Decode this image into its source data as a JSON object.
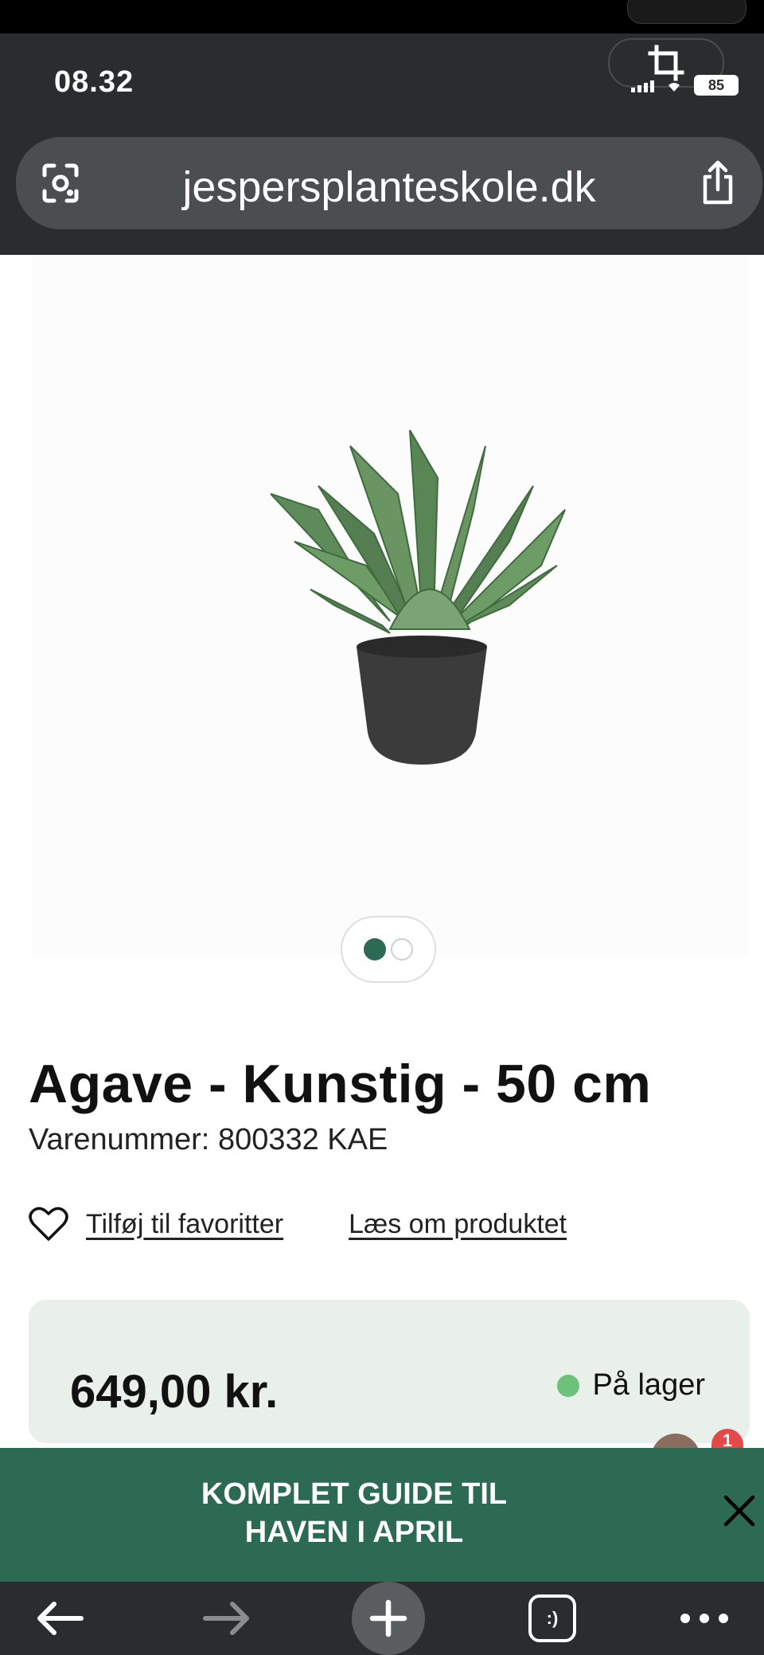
{
  "status_bar": {
    "time": "08.32",
    "battery": "85"
  },
  "browser": {
    "url": "jespersplanteskole.dk",
    "icons": [
      "lens-icon",
      "share-icon",
      "crop-icon"
    ]
  },
  "gallery": {
    "image_alt": "Agave - Kunstig - 50 cm",
    "slide_count": 2,
    "active_slide": 1
  },
  "product": {
    "title": "Agave - Kunstig - 50 cm",
    "sku_label": "Varenummer:",
    "sku": "800332 KAE",
    "favorite_label": "Tilføj til favoritter",
    "read_more_label": "Læs om produktet",
    "price": "649,00 kr.",
    "stock_status": "På lager",
    "stock_color": "#6cc27a"
  },
  "chat": {
    "badge_count": "1"
  },
  "promo_banner": {
    "line1": "KOMPLET GUIDE TIL",
    "line2": "HAVEN I APRIL",
    "close_icon": "close-icon",
    "background": "#2c6a54"
  },
  "bottom_toolbar": {
    "back_icon": "arrow-left-icon",
    "forward_icon": "arrow-right-icon",
    "new_tab_icon": "plus-icon",
    "tabs_label": ":)",
    "menu_icon": "more-icon"
  }
}
